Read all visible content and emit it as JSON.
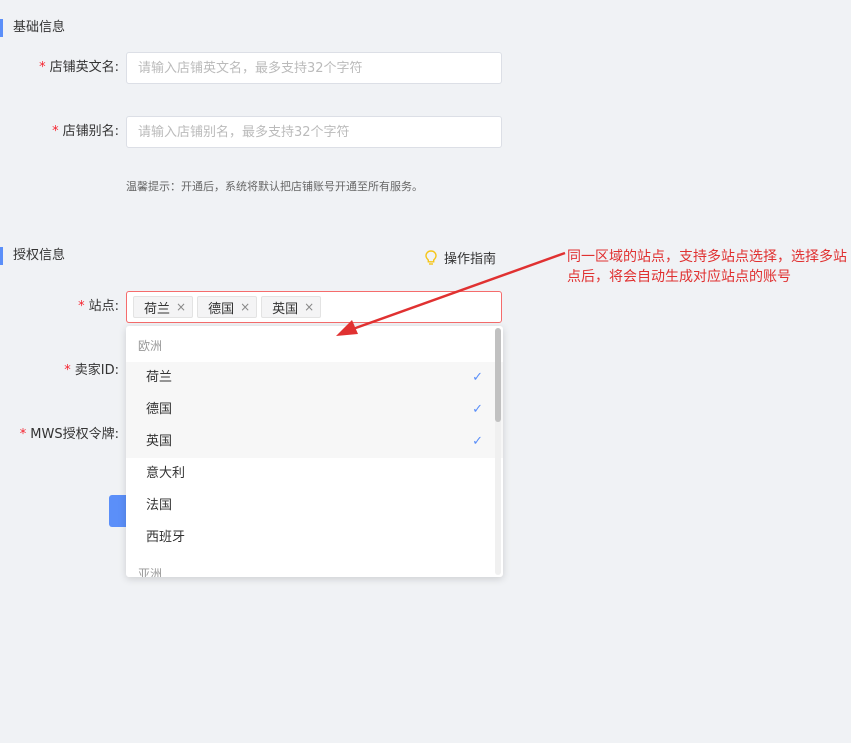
{
  "basic_section": {
    "title": "基础信息"
  },
  "fields": {
    "store_en_name": {
      "label": "店铺英文名:",
      "placeholder": "请输入店铺英文名，最多支持32个字符"
    },
    "store_alias": {
      "label": "店铺别名:",
      "placeholder": "请输入店铺别名，最多支持32个字符"
    },
    "hint": "温馨提示：开通后，系统将默认把店铺账号开通至所有服务。"
  },
  "auth_section": {
    "title": "授权信息",
    "guide_label": "操作指南",
    "guide_icon": "lightbulb-icon"
  },
  "site": {
    "label": "站点:",
    "tags": [
      "荷兰",
      "德国",
      "英国"
    ],
    "tag_close": "×"
  },
  "seller_id": {
    "label": "卖家ID:"
  },
  "mws_token": {
    "label": "MWS授权令牌:"
  },
  "dropdown": {
    "group_europe": "欧洲",
    "europe_options": [
      {
        "label": "荷兰",
        "selected": true
      },
      {
        "label": "德国",
        "selected": true
      },
      {
        "label": "英国",
        "selected": true
      },
      {
        "label": "意大利",
        "selected": false
      },
      {
        "label": "法国",
        "selected": false
      },
      {
        "label": "西班牙",
        "selected": false
      }
    ],
    "group_asia": "亚洲",
    "check_glyph": "✓"
  },
  "annotation": "同一区域的站点，支持多站点选择，选择多站点后，将会自动生成对应站点的账号",
  "colors": {
    "accent": "#5b8ff9",
    "required": "#f5222d",
    "annotation": "#e03131",
    "error_border": "#f56c6c"
  }
}
